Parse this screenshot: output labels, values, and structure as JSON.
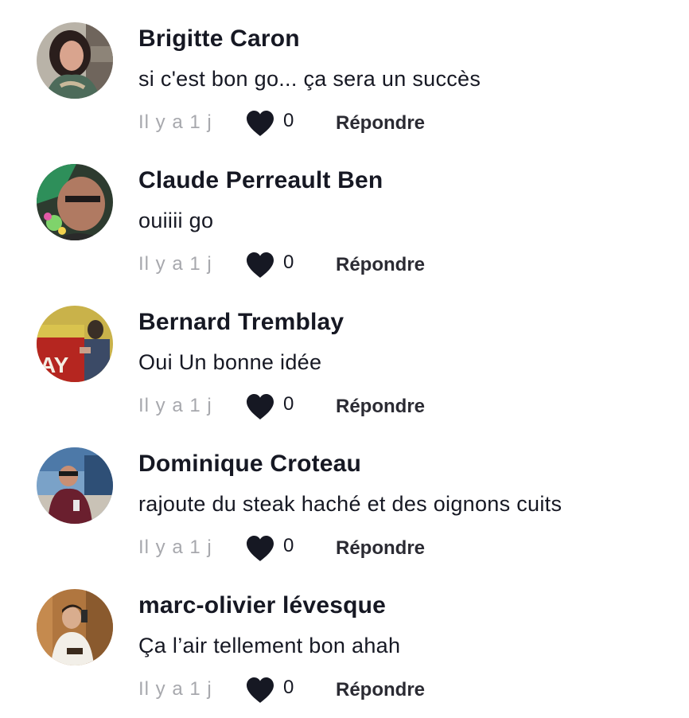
{
  "comments": [
    {
      "author": "Brigitte Caron",
      "text": "si c'est bon go... ça sera un succès",
      "time": "Il y a 1 j",
      "likes": "0",
      "reply_label": "Répondre"
    },
    {
      "author": "Claude Perreault Ben",
      "text": "ouiiii go",
      "time": "Il y a 1 j",
      "likes": "0",
      "reply_label": "Répondre"
    },
    {
      "author": "Bernard Tremblay",
      "text": "Oui Un bonne idée",
      "time": "Il y a 1 j",
      "likes": "0",
      "reply_label": "Répondre"
    },
    {
      "author": "Dominique Croteau",
      "text": "rajoute du steak haché et des oignons cuits",
      "time": "Il y a 1 j",
      "likes": "0",
      "reply_label": "Répondre"
    },
    {
      "author": "marc-olivier lévesque",
      "text": "Ça l’air tellement bon ahah",
      "time": "Il y a 1 j",
      "likes": "0",
      "reply_label": "Répondre"
    }
  ],
  "icons": {
    "like": "heart-icon"
  },
  "colors": {
    "text_primary": "#161823",
    "text_muted": "#a7a8ad",
    "heart": "#161823"
  }
}
